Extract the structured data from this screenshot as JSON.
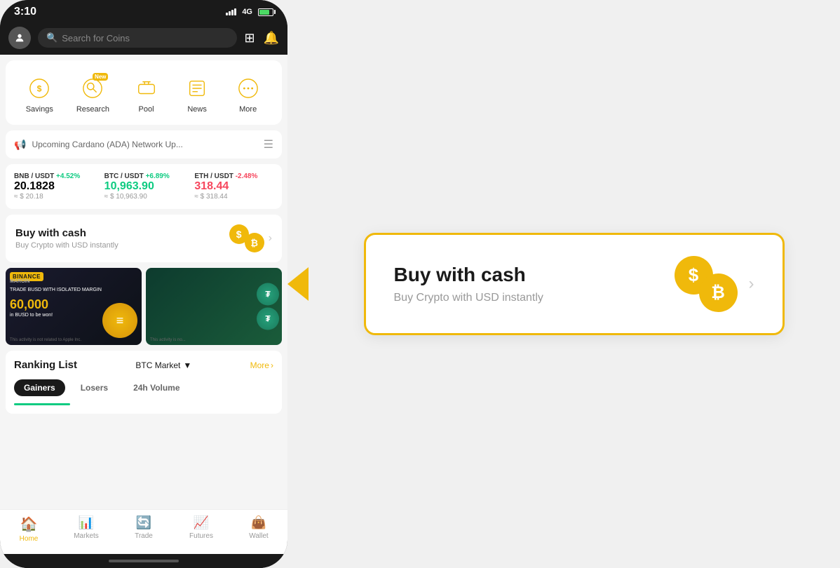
{
  "status_bar": {
    "time": "3:10",
    "signal": "4G",
    "battery": "charging"
  },
  "search": {
    "placeholder": "Search for Coins"
  },
  "quick_actions": [
    {
      "id": "savings",
      "label": "Savings",
      "icon": "savings"
    },
    {
      "id": "research",
      "label": "Research",
      "icon": "research",
      "badge": "New"
    },
    {
      "id": "pool",
      "label": "Pool",
      "icon": "pool"
    },
    {
      "id": "news",
      "label": "News",
      "icon": "news"
    },
    {
      "id": "more",
      "label": "More",
      "icon": "more"
    }
  ],
  "announcement": {
    "text": "Upcoming Cardano (ADA) Network Up..."
  },
  "tickers": [
    {
      "pair": "BNB / USDT",
      "change": "+4.52%",
      "price": "20.1828",
      "usd": "≈ $ 20.18",
      "direction": "up"
    },
    {
      "pair": "BTC / USDT",
      "change": "+6.89%",
      "price": "10,963.90",
      "usd": "≈ $ 10,963.90",
      "direction": "up"
    },
    {
      "pair": "ETH / USDT",
      "change": "-2.48%",
      "price": "318.44",
      "usd": "≈ $ 318.44",
      "direction": "down"
    }
  ],
  "buy_cash_card": {
    "title": "Buy with cash",
    "subtitle": "Buy Crypto with USD instantly"
  },
  "promo_banners": [
    {
      "brand": "BINANCE",
      "sub": "MARGIN",
      "trade_text": "TRADE BUSD WITH ISOLATED MARGIN",
      "amount": "60,000",
      "unit": "in BUSD to be won!",
      "disclaimer": "This activity is not related to Apple Inc."
    },
    {
      "disclaimer": "This activity is no..."
    }
  ],
  "ranking": {
    "title": "Ranking List",
    "market": "BTC Market",
    "more": "More",
    "tabs": [
      {
        "label": "Gainers",
        "active": true
      },
      {
        "label": "Losers",
        "active": false
      },
      {
        "label": "24h Volume",
        "active": false
      }
    ]
  },
  "bottom_nav": [
    {
      "id": "home",
      "label": "Home",
      "icon": "🏠",
      "active": true
    },
    {
      "id": "markets",
      "label": "Markets",
      "icon": "📊",
      "active": false
    },
    {
      "id": "trade",
      "label": "Trade",
      "icon": "🔄",
      "active": false
    },
    {
      "id": "futures",
      "label": "Futures",
      "icon": "📈",
      "active": false
    },
    {
      "id": "wallet",
      "label": "Wallet",
      "icon": "👜",
      "active": false
    }
  ],
  "enlarged_card": {
    "title": "Buy with cash",
    "subtitle": "Buy Crypto with USD instantly"
  }
}
